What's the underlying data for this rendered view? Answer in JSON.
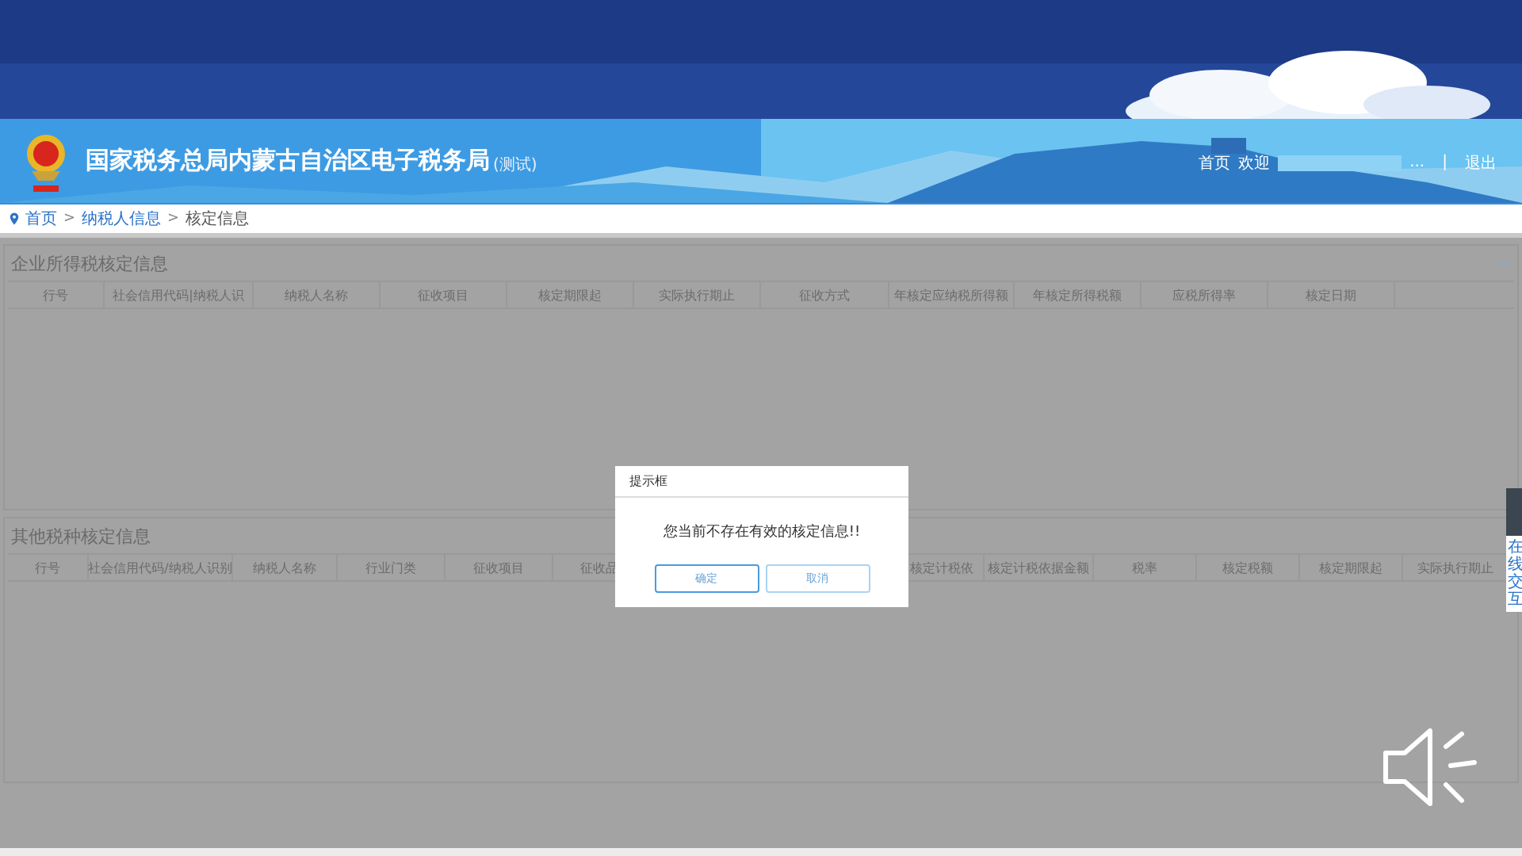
{
  "header": {
    "title": "国家税务总局内蒙古自治区电子税务局",
    "title_suffix": "(测试)",
    "nav": {
      "home": "首页",
      "welcome": "欢迎",
      "ellipsis": "...",
      "separator": "|",
      "logout": "退出"
    }
  },
  "breadcrumb": {
    "items": [
      "首页",
      "纳税人信息",
      "核定信息"
    ],
    "separator": ">"
  },
  "sections": [
    {
      "title": "企业所得税核定信息",
      "columns": [
        "行号",
        "社会信用代码|纳税人识",
        "纳税人名称",
        "征收项目",
        "核定期限起",
        "实际执行期止",
        "征收方式",
        "年核定应纳税所得额",
        "年核定所得税额",
        "应税所得率",
        "核定日期"
      ]
    },
    {
      "title": "其他税种核定信息",
      "columns": [
        "行号",
        "社会信用代码/纳税人识别",
        "纳税人名称",
        "行业门类",
        "征收项目",
        "征收品",
        "核定计税依",
        "核定计税依据金额",
        "税率",
        "核定税额",
        "核定期限起",
        "实际执行期止"
      ]
    }
  ],
  "dialog": {
    "title": "提示框",
    "message": "您当前不存在有效的核定信息!!",
    "buttons": [
      "确定",
      "取消"
    ]
  },
  "side_widget": {
    "label": "在线交互"
  }
}
